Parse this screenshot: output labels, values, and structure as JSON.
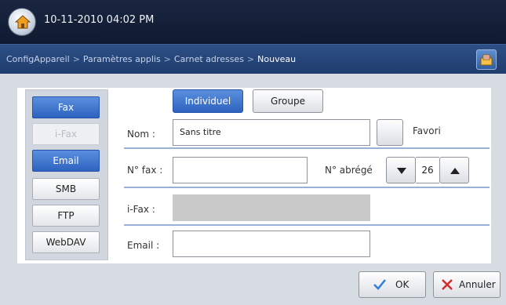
{
  "status_bar": {
    "datetime": "10-11-2010 04:02 PM",
    "home_icon": "home-icon"
  },
  "breadcrumb": {
    "items": [
      "ConfigAppareil",
      "Paramètres applis",
      "Carnet adresses",
      "Nouveau"
    ],
    "separator": ">",
    "corner_icon": "address-book-icon"
  },
  "sidebar": {
    "items": [
      {
        "label": "Fax",
        "state": "active"
      },
      {
        "label": "i-Fax",
        "state": "disabled"
      },
      {
        "label": "Email",
        "state": "active"
      },
      {
        "label": "SMB",
        "state": "normal"
      },
      {
        "label": "FTP",
        "state": "normal"
      },
      {
        "label": "WebDAV",
        "state": "normal"
      }
    ]
  },
  "tabs": {
    "individual": "Individuel",
    "group": "Groupe",
    "selected": "Individuel"
  },
  "form": {
    "name_label": "Nom :",
    "name_value": "Sans titre",
    "favorite_label": "Favori",
    "fax_label": "N° fax :",
    "fax_value": "",
    "speed_dial_label": "N° abrégé",
    "speed_dial_value": "26",
    "ifax_label": "i-Fax :",
    "ifax_value": "",
    "email_label": "Email :",
    "email_value": ""
  },
  "actions": {
    "ok_label": "OK",
    "cancel_label": "Annuler"
  },
  "colors": {
    "accent": "#2d63c0",
    "topbar": "#0f1a30",
    "breadcrumb_bar": "#1f3d6e",
    "ok_check": "#2f7fd6",
    "cancel_x": "#d42a2a"
  }
}
